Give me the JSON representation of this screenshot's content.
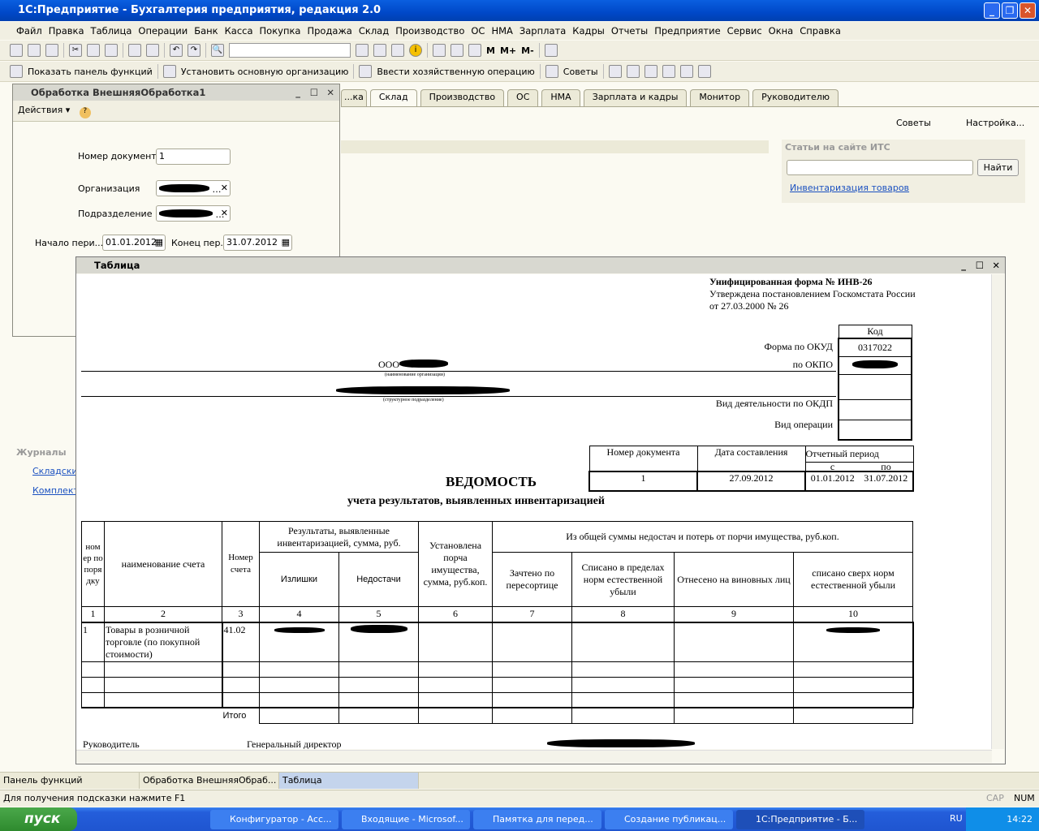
{
  "app": {
    "title": "1С:Предприятие - Бухгалтерия предприятия, редакция 2.0"
  },
  "menu": [
    "Файл",
    "Правка",
    "Таблица",
    "Операции",
    "Банк",
    "Касса",
    "Покупка",
    "Продажа",
    "Склад",
    "Производство",
    "ОС",
    "НМА",
    "Зарплата",
    "Кадры",
    "Отчеты",
    "Предприятие",
    "Сервис",
    "Окна",
    "Справка"
  ],
  "toolbar2": {
    "show_panel": "Показать панель функций",
    "set_org": "Установить основную организацию",
    "enter_op": "Ввести хозяйственную операцию",
    "tips": "Советы"
  },
  "toolbar1": {
    "m": "M",
    "mplus": "M+",
    "mminus": "M-",
    "search_value": ""
  },
  "tabs": [
    "...ка",
    "Склад",
    "Производство",
    "ОС",
    "НМА",
    "Зарплата и кадры",
    "Монитор",
    "Руководителю"
  ],
  "panel": {
    "tips": "Советы",
    "settings": "Настройка...",
    "its_title": "Статьи на сайте ИТС",
    "find": "Найти",
    "its_link": "Инвентаризация товаров",
    "journals": "Журналы",
    "j1": "Складски",
    "j2": "Комплект"
  },
  "proc": {
    "title": "Обработка  ВнешняяОбработка1",
    "actions": "Действия ▾",
    "doc_num_label": "Номер документа",
    "doc_num": "1",
    "org_label": "Организация",
    "dept_label": "Подразделение",
    "start_label": "Начало пери...",
    "start": "01.01.2012",
    "end_label": "Конец пер...",
    "end": "31.07.2012"
  },
  "tablewin": {
    "title": "Таблица"
  },
  "form": {
    "unified": "Унифицированная форма № ИНВ-26",
    "approved": "Утверждена постановлением Госкомстата России",
    "approved_date": "от 27.03.2000 № 26",
    "kod": "Код",
    "okud_label": "Форма по ОКУД",
    "okud": "0317022",
    "okpo_label": "по ОКПО",
    "okdp_label": "Вид деятельности по ОКДП",
    "op_label": "Вид операции",
    "org_prefix": "ООО",
    "org_caption": "(наименование организации)",
    "dept_caption": "(структурное подразделение)",
    "docnum_h": "Номер документа",
    "date_h": "Дата составления",
    "period_h": "Отчетный период",
    "from_h": "с",
    "to_h": "по",
    "docnum": "1",
    "date": "27.09.2012",
    "from": "01.01.2012",
    "to": "31.07.2012",
    "title": "ВЕДОМОСТЬ",
    "subtitle": "учета результатов, выявленных инвентаризацией",
    "headers": {
      "num": "ном ер по поря дку",
      "name": "наименование счета",
      "acc": "Номер счета",
      "results": "Результаты, выявленные инвентаризацией, сумма, руб.",
      "surplus": "Излишки",
      "shortage": "Недостачи",
      "damage": "Установлена порча имущества, сумма, руб.коп.",
      "of_total": "Из общей суммы недостач и потерь от порчи имущества, руб.коп.",
      "c7": "Зачтено по пересортице",
      "c8": "Списано в пределах норм естественной убыли",
      "c9": "Отнесено на виновных лиц",
      "c10": "списано сверх норм естественной убыли"
    },
    "colnums": [
      "1",
      "2",
      "3",
      "4",
      "5",
      "6",
      "7",
      "8",
      "9",
      "10"
    ],
    "row1": {
      "n": "1",
      "name": "Товары в розничной торговле (по покупной стоимости)",
      "acc": "41.02"
    },
    "total": "Итого",
    "head_label": "Руководитель",
    "head_pos": "Генеральный директор"
  },
  "windows": [
    "Панель функций",
    "Обработка  ВнешняяОбраб...",
    "Таблица"
  ],
  "status": {
    "hint": "Для получения подсказки нажмите F1",
    "cap": "CAP",
    "num": "NUM"
  },
  "taskbar": {
    "start": "пуск",
    "tasks": [
      "Конфигуратор - Асс...",
      "Входящие - Microsof...",
      "Памятка для перед...",
      "Создание публикац...",
      "1С:Предприятие - Б..."
    ],
    "lang": "RU",
    "time": "14:22"
  }
}
